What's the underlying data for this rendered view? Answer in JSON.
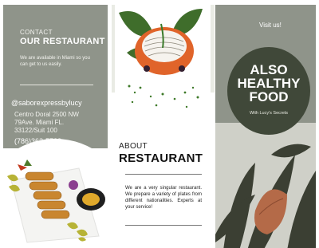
{
  "panel_left": {
    "contact_label": "CONTACT",
    "contact_title": "OUR RESTAURANT",
    "availability_text": "We are available in Miami so you can get to us easily.",
    "handle": "@saborexpressbylucy",
    "address_line1": "Centro Doral 2500 NW",
    "address_line2": "79Ave. Miami FL.",
    "address_line3": "33122/Suit 100",
    "phone": "(786)362-5723"
  },
  "panel_middle": {
    "about_label": "ABOUT",
    "about_title": "RESTAURANT",
    "description": "We are a very singular restaurant. We prepare a variety of plates from different nationalities. Experts at your service!"
  },
  "panel_right": {
    "visit_text": "Visit us!",
    "headline_1": "ALSO",
    "headline_2": "HEALTHY",
    "headline_3": "FOOD",
    "subheadline": "With Lucy's Secrets"
  },
  "colors": {
    "sage": "#8f948a",
    "dark_olive": "#404839",
    "white": "#ffffff"
  }
}
